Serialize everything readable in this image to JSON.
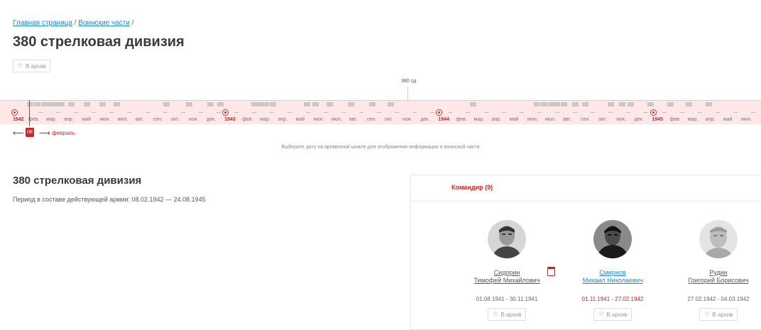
{
  "breadcrumb": {
    "items": [
      "Главная страница",
      "Воинские части"
    ],
    "separator": "/"
  },
  "page_title": "380 стрелковая дивизия",
  "archive_label": "В архив",
  "timeline": {
    "top_label": "380 сд",
    "start_year": "1942",
    "months": [
      "фев.",
      "мар.",
      "апр.",
      "май",
      "июн.",
      "июл.",
      "авг.",
      "сен.",
      "окт.",
      "ноя.",
      "дек.",
      "1943",
      "фев.",
      "мар.",
      "апр.",
      "май",
      "июн.",
      "июл.",
      "авг.",
      "сен.",
      "окт.",
      "ноя.",
      "дек.",
      "1944",
      "фев.",
      "мар.",
      "апр.",
      "май",
      "июн.",
      "июл.",
      "авг.",
      "сен.",
      "окт.",
      "ноя.",
      "дек.",
      "1945",
      "фев.",
      "мар.",
      "апр.",
      "май",
      "июн."
    ],
    "selected_day": "08",
    "selected_month": "февраль",
    "hint": "Выберите дату на временной шкале для отображения информации о воинской части",
    "accent_color": "#c62828"
  },
  "unit_info": {
    "title": "380 стрелковая дивизия",
    "period": "Период в составе действующей армии: 08.02.1942 — 24.08.1945"
  },
  "panel": {
    "tab_label": "Командир (9)",
    "commanders": [
      {
        "surname": "Сидорин",
        "name": "Тимофей Михайлович",
        "dates": "01.08.1941 - 30.11.1941",
        "active": false
      },
      {
        "surname": "Смирнов",
        "name": "Михаил Николаевич",
        "dates": "01.11.1941 - 27.02.1942",
        "active": true
      },
      {
        "surname": "Рудин",
        "name": "Григорий Борисович",
        "dates": "27.02.1942 - 04.03.1942",
        "active": false
      }
    ]
  }
}
